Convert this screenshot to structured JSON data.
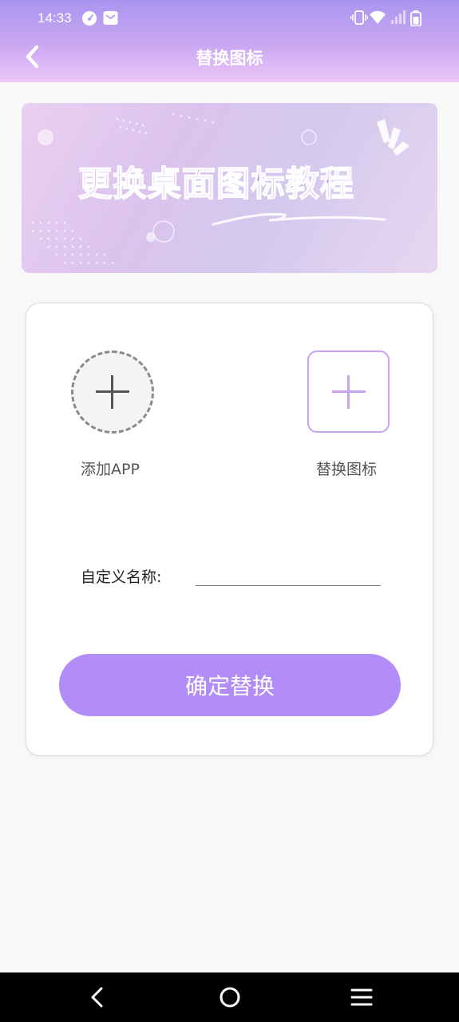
{
  "status_bar": {
    "time": "14:33",
    "left_icons": [
      "speedometer-icon",
      "mail-icon"
    ],
    "right_icons": [
      "vibrate-icon",
      "wifi-icon",
      "signal-icon",
      "battery-icon"
    ]
  },
  "header": {
    "title": "替换图标",
    "back_icon": "chevron-left-icon"
  },
  "banner": {
    "text": "更换桌面图标教程"
  },
  "card": {
    "add_app_label": "添加APP",
    "replace_icon_label": "替换图标",
    "name_label": "自定义名称:",
    "name_value": "",
    "name_placeholder": "",
    "confirm_label": "确定替换"
  },
  "nav_bar": {
    "icons": [
      "back-triangle-icon",
      "home-circle-icon",
      "menu-icon"
    ]
  },
  "colors": {
    "header_gradient_top": "#a995f0",
    "header_gradient_bottom": "#ecc7f5",
    "accent": "#b28cf7",
    "replace_border": "#c8a3ef"
  }
}
